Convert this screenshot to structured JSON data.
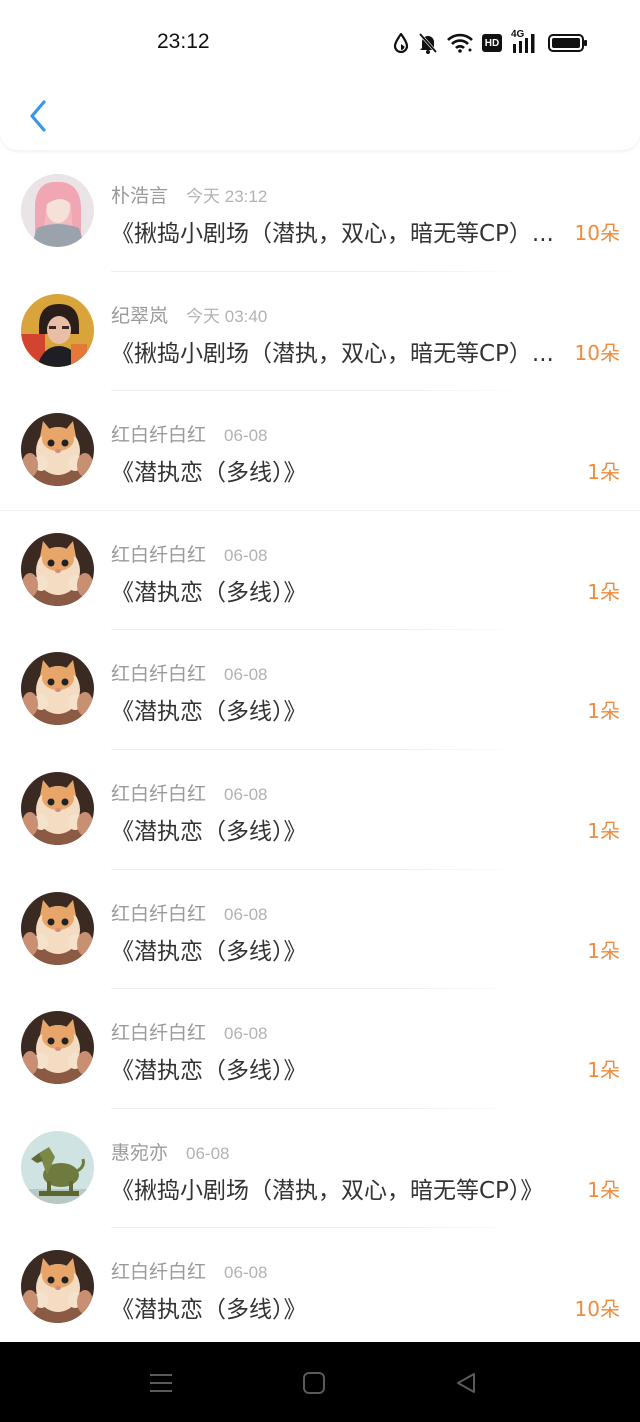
{
  "status_bar": {
    "time": "23:12",
    "icons": [
      "water-drop-icon",
      "bell-muted-icon",
      "wifi-icon",
      "hd-icon",
      "4g-signal-icon",
      "battery-icon"
    ],
    "hd_label": "HD",
    "net_label": "4G"
  },
  "header": {
    "back_icon": "chevron-left-icon",
    "accent_color": "#3a97e8"
  },
  "rows": [
    {
      "name": "朴浩言",
      "time": "今天 23:12",
      "title": "《揪捣小剧场（潜执，双心，暗无等CP）...",
      "flowers": "10朵",
      "avatar": "girl-pink-hair"
    },
    {
      "name": "纪翠岚",
      "time": "今天 03:40",
      "title": "《揪捣小剧场（潜执，双心，暗无等CP）...",
      "flowers": "10朵",
      "avatar": "girl-dark-hair"
    },
    {
      "name": "红白纤白红",
      "time": "06-08",
      "title": "《潜执恋（多线）》",
      "flowers": "1朵",
      "avatar": "cat"
    },
    {
      "name": "红白纤白红",
      "time": "06-08",
      "title": "《潜执恋（多线）》",
      "flowers": "1朵",
      "avatar": "cat"
    },
    {
      "name": "红白纤白红",
      "time": "06-08",
      "title": "《潜执恋（多线）》",
      "flowers": "1朵",
      "avatar": "cat"
    },
    {
      "name": "红白纤白红",
      "time": "06-08",
      "title": "《潜执恋（多线）》",
      "flowers": "1朵",
      "avatar": "cat"
    },
    {
      "name": "红白纤白红",
      "time": "06-08",
      "title": "《潜执恋（多线）》",
      "flowers": "1朵",
      "avatar": "cat"
    },
    {
      "name": "红白纤白红",
      "time": "06-08",
      "title": "《潜执恋（多线）》",
      "flowers": "1朵",
      "avatar": "cat"
    },
    {
      "name": "惠宛亦",
      "time": "06-08",
      "title": "《揪捣小剧场（潜执，双心，暗无等CP）》",
      "flowers": "1朵",
      "avatar": "dog-statue"
    },
    {
      "name": "红白纤白红",
      "time": "06-08",
      "title": "《潜执恋（多线）》",
      "flowers": "10朵",
      "avatar": "cat"
    }
  ],
  "colors": {
    "flower_count": "#f08a3c",
    "name_gray": "#9a9a9a",
    "title_text": "#333333"
  },
  "nav_bar": {
    "buttons": [
      "menu-icon",
      "home-square-icon",
      "back-triangle-icon"
    ]
  }
}
